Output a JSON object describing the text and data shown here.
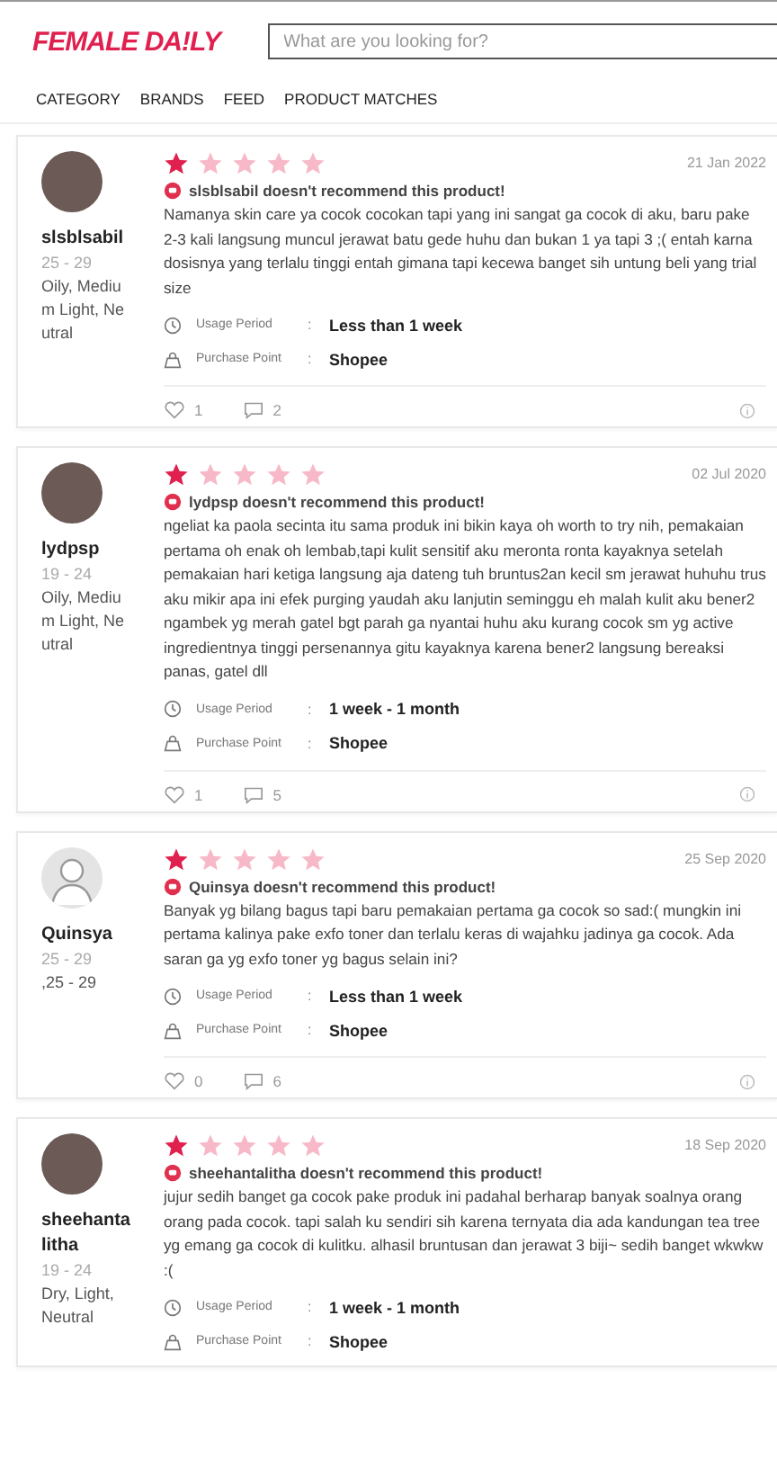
{
  "header": {
    "logo": "FEMALE DA!LY",
    "search": {
      "placeholder": "What are you looking for?"
    }
  },
  "nav": [
    {
      "label": "CATEGORY"
    },
    {
      "label": "BRANDS"
    },
    {
      "label": "FEED"
    },
    {
      "label": "PRODUCT MATCHES"
    }
  ],
  "reviews": [
    {
      "avatar": {
        "kind": "photo"
      },
      "username": "slsblsabil",
      "age": "25 - 29",
      "skin": "Oily, Medium Light, Neutral",
      "stars": 1,
      "date": "21 Jan 2022",
      "verdict": "slsblsabil doesn't recommend this product!",
      "text": "Namanya skin care ya cocok cocokan tapi yang ini sangat ga cocok di aku, baru pake 2-3 kali langsung muncul jerawat batu gede huhu dan bukan 1 ya tapi 3 ;( entah karna dosisnya yang terlalu tinggi entah gimana tapi kecewa banget sih untung beli yang trial size",
      "details": [
        {
          "kind": "usage",
          "label": "Usage Period",
          "sep": ":",
          "value": "Less than 1 week"
        },
        {
          "kind": "purchase",
          "label": "Purchase Point",
          "sep": ":",
          "value": "Shopee"
        }
      ],
      "likes": "1",
      "comments": "2"
    },
    {
      "avatar": {
        "kind": "photo"
      },
      "username": "lydpsp",
      "age": "19 - 24",
      "skin": "Oily, Medium Light, Neutral",
      "stars": 1,
      "date": "02 Jul 2020",
      "verdict": "lydpsp doesn't recommend this product!",
      "text": "ngeliat ka paola secinta itu sama produk ini bikin kaya oh worth to try nih, pemakaian pertama oh enak oh lembab,tapi kulit sensitif aku meronta ronta kayaknya setelah pemakaian hari ketiga langsung aja dateng tuh bruntus2an kecil sm jerawat huhuhu trus aku mikir apa ini efek purging yaudah aku lanjutin seminggu eh malah kulit aku bener2 ngambek yg merah gatel bgt parah ga nyantai huhu aku kurang cocok sm yg active ingredientnya tinggi persenannya gitu kayaknya karena bener2 langsung bereaksi panas, gatel dll",
      "details": [
        {
          "kind": "usage",
          "label": "Usage Period",
          "sep": ":",
          "value": "1 week - 1 month"
        },
        {
          "kind": "purchase",
          "label": "Purchase Point",
          "sep": ":",
          "value": "Shopee"
        }
      ],
      "likes": "1",
      "comments": "5"
    },
    {
      "avatar": {
        "kind": "default"
      },
      "username": "Quinsya",
      "age": "25 - 29",
      "skin": ",25 - 29",
      "stars": 1,
      "date": "25 Sep 2020",
      "verdict": "Quinsya doesn't recommend this product!",
      "text": "Banyak yg bilang bagus tapi baru pemakaian pertama ga cocok so sad:( mungkin ini pertama kalinya pake exfo toner dan terlalu keras di wajahku jadinya ga cocok. Ada saran ga yg exfo toner yg bagus selain ini?",
      "details": [
        {
          "kind": "usage",
          "label": "Usage Period",
          "sep": ":",
          "value": "Less than 1 week"
        },
        {
          "kind": "purchase",
          "label": "Purchase Point",
          "sep": ":",
          "value": "Shopee"
        }
      ],
      "likes": "0",
      "comments": "6"
    },
    {
      "avatar": {
        "kind": "photo"
      },
      "username": "sheehantalitha",
      "age": "19 - 24",
      "skin": "Dry, Light, Neutral",
      "stars": 1,
      "date": "18 Sep 2020",
      "verdict": "sheehantalitha doesn't recommend this product!",
      "text": "jujur sedih banget ga cocok pake produk ini padahal berharap banyak soalnya orang orang pada cocok. tapi salah ku sendiri sih karena ternyata dia ada kandungan tea tree yg emang ga cocok di kulitku. alhasil bruntusan dan jerawat 3 biji~ sedih banget wkwkw :(",
      "details": [
        {
          "kind": "usage",
          "label": "Usage Period",
          "sep": ":",
          "value": "1 week - 1 month"
        },
        {
          "kind": "purchase",
          "label": "Purchase Point",
          "sep": ":",
          "value": "Shopee"
        }
      ]
    }
  ]
}
